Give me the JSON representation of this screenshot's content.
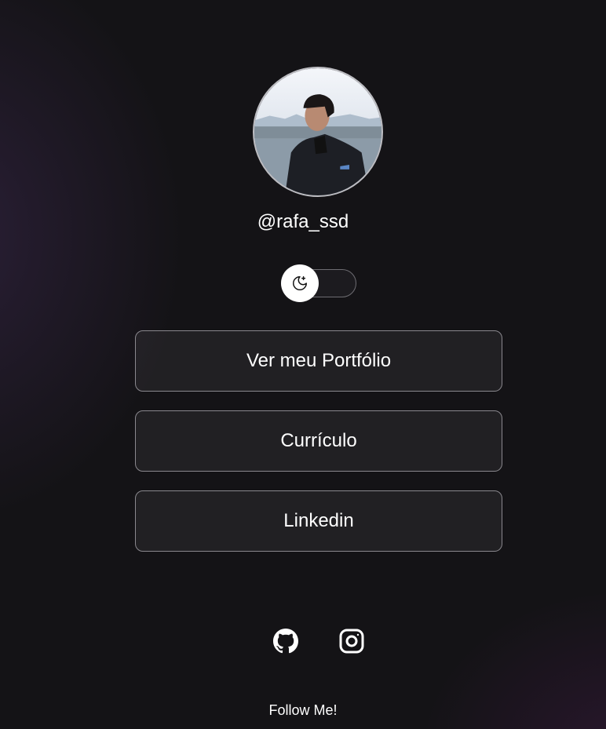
{
  "profile": {
    "handle": "@rafa_ssd",
    "avatar_icon": "profile-photo"
  },
  "theme_toggle": {
    "icon": "moon-stars-icon",
    "state": "dark"
  },
  "links": [
    {
      "label": "Ver meu Portfólio"
    },
    {
      "label": "Currículo"
    },
    {
      "label": "Linkedin"
    }
  ],
  "social": {
    "icons": [
      "github-icon",
      "instagram-icon"
    ],
    "footer": "Follow Me!"
  },
  "colors": {
    "background": "#141316",
    "accent": "#ffffff",
    "border": "#8a888e"
  }
}
